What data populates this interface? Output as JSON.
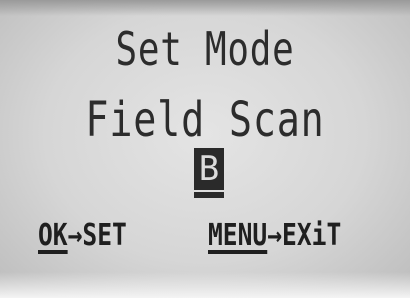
{
  "display": {
    "title": "Set Mode",
    "subtitle": "Field Scan",
    "selected_value": "B"
  },
  "softkeys": {
    "ok": {
      "key": "OK",
      "arrow": "→",
      "action": "SET"
    },
    "menu": {
      "key": "MENU",
      "arrow": "→",
      "action": "EXiT"
    }
  },
  "colors": {
    "lcd_background": "#d6d6d6",
    "lcd_text": "#2c2c2c",
    "highlight": "#2a2a2a"
  }
}
